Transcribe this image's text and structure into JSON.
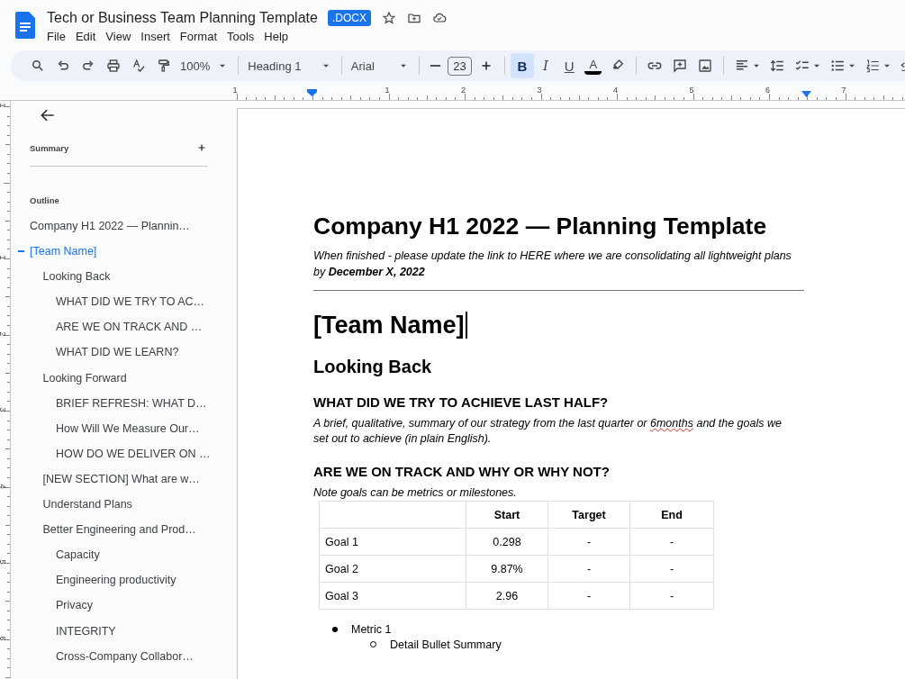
{
  "app_bar": {
    "title": "Tech or Business Team Planning Template",
    "badge": ".DOCX",
    "menu": [
      "File",
      "Edit",
      "View",
      "Insert",
      "Format",
      "Tools",
      "Help"
    ]
  },
  "toolbar": {
    "zoom": "100%",
    "style": "Heading 1",
    "font": "Arial",
    "font_size": "23",
    "format_buttons": [
      {
        "label": "B",
        "selected": true
      },
      {
        "label": "I",
        "selected": false
      },
      {
        "label": "U",
        "selected": false
      }
    ],
    "text_color": {
      "label": "A",
      "color": "#000000"
    }
  },
  "ruler": {
    "labels": [
      "1",
      "1",
      "2",
      "3",
      "4",
      "5",
      "6",
      "7"
    ]
  },
  "vertical_ruler": {
    "labels": [
      "1",
      "1",
      "2",
      "3",
      "4",
      "5",
      "6"
    ]
  },
  "sidebar": {
    "summary_label": "Summary",
    "outline_label": "Outline",
    "outline": [
      {
        "text": "Company H1 2022 — Plannin…",
        "selected": false
      },
      {
        "text": "[Team Name]",
        "selected": true,
        "children": [
          {
            "text": "Looking Back",
            "selected": false,
            "children": [
              {
                "text": "WHAT DID WE TRY TO AC…",
                "selected": false
              },
              {
                "text": "ARE WE ON TRACK AND …",
                "selected": false
              },
              {
                "text": "WHAT DID WE LEARN?",
                "selected": false
              }
            ]
          },
          {
            "text": "Looking Forward",
            "selected": false,
            "children": [
              {
                "text": "BRIEF REFRESH: WHAT D…",
                "selected": false
              },
              {
                "text": "How Will We Measure Our…",
                "selected": false
              },
              {
                "text": "HOW DO WE DELIVER ON …",
                "selected": false
              }
            ]
          },
          {
            "text": "[NEW SECTION] What are w…",
            "selected": false
          },
          {
            "text": "Understand Plans",
            "selected": false
          },
          {
            "text": "Better Engineering and Prod…",
            "selected": false,
            "children": [
              {
                "text": "Capacity",
                "selected": false
              },
              {
                "text": "Engineering productivity",
                "selected": false
              },
              {
                "text": "Privacy",
                "selected": false
              },
              {
                "text": "INTEGRITY",
                "selected": false
              },
              {
                "text": "Cross-Company Collabor…",
                "selected": false
              }
            ]
          }
        ]
      }
    ]
  },
  "document": [
    {
      "kind": "title",
      "text": "Company H1 2022 — Planning Template"
    },
    {
      "kind": "note",
      "text": "When finished - please update the link to HERE where we are consolidating all lightweight plans by **December X, 2022**"
    },
    {
      "kind": "rule"
    },
    {
      "kind": "heading1",
      "text": "[Team Name]",
      "cursor": true
    },
    {
      "kind": "heading2",
      "text": "Looking Back"
    },
    {
      "kind": "heading3",
      "text": "WHAT DID WE TRY TO ACHIEVE LAST HALF?"
    },
    {
      "kind": "paragraph",
      "segments": [
        {
          "text": "A brief, qualitative, summary of our strategy from the last quarter or ",
          "misspelled": false
        },
        {
          "text": "6months",
          "misspelled": true
        },
        {
          "text": " and the goals we set out to achieve (in plain English).",
          "misspelled": false
        }
      ]
    },
    {
      "kind": "heading3",
      "text": "ARE WE ON TRACK AND WHY OR WHY NOT?"
    },
    {
      "kind": "note_plain",
      "text": "Note goals can be metrics or milestones."
    },
    {
      "kind": "table",
      "columns": [
        "",
        "Start",
        "Target",
        "End"
      ],
      "rows": [
        [
          "Goal 1",
          "0.298",
          "-",
          "-"
        ],
        [
          "Goal 2",
          "9.87%",
          "-",
          "-"
        ],
        [
          "Goal 3",
          "2.96",
          "-",
          "-"
        ]
      ]
    },
    {
      "kind": "bullets",
      "items": [
        {
          "text": "Metric 1",
          "children": [
            {
              "text": "Detail Bullet Summary"
            }
          ]
        }
      ]
    }
  ]
}
